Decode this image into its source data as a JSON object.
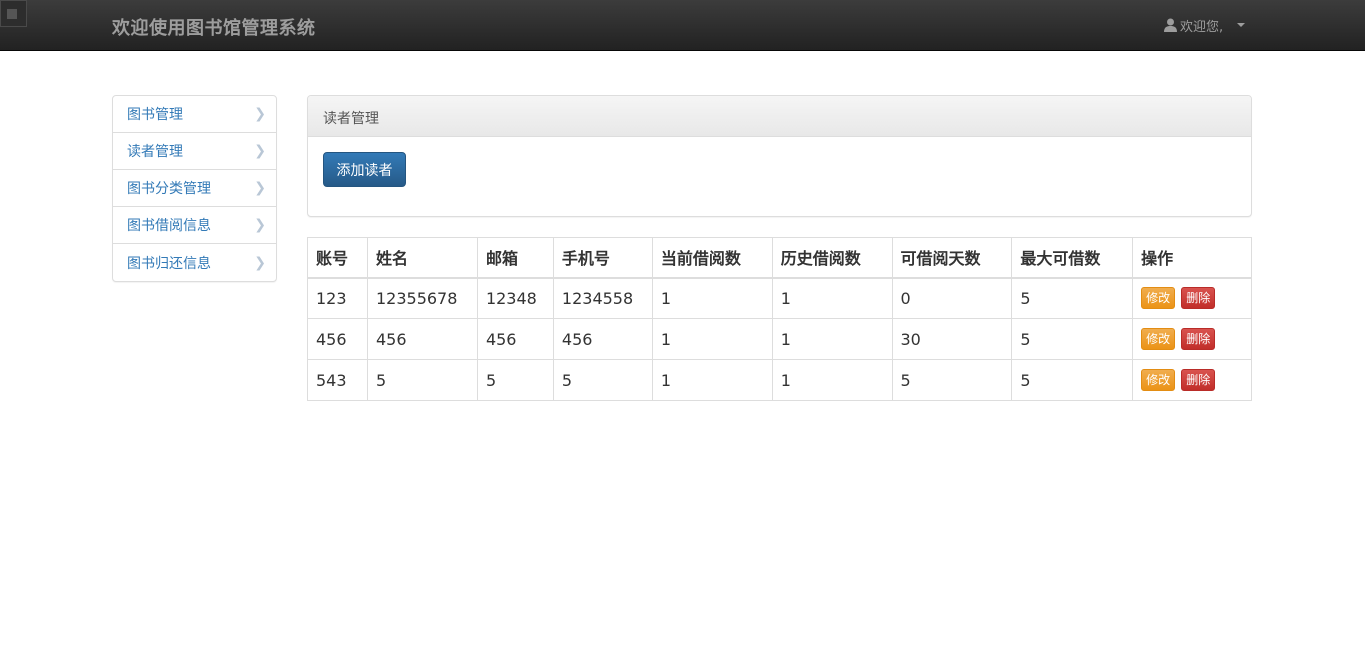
{
  "header": {
    "brand": "欢迎使用图书馆管理系统",
    "welcome": "欢迎您,"
  },
  "sidebar": {
    "items": [
      {
        "label": "图书管理"
      },
      {
        "label": "读者管理"
      },
      {
        "label": "图书分类管理"
      },
      {
        "label": "图书借阅信息"
      },
      {
        "label": "图书归还信息"
      }
    ]
  },
  "panel": {
    "title": "读者管理",
    "add_button": "添加读者"
  },
  "table": {
    "columns": [
      "账号",
      "姓名",
      "邮箱",
      "手机号",
      "当前借阅数",
      "历史借阅数",
      "可借阅天数",
      "最大可借数",
      "操作"
    ],
    "rows": [
      [
        "123",
        "12355678",
        "12348",
        "1234558",
        "1",
        "1",
        "0",
        "5"
      ],
      [
        "456",
        "456",
        "456",
        "456",
        "1",
        "1",
        "30",
        "5"
      ],
      [
        "543",
        "5",
        "5",
        "5",
        "1",
        "1",
        "5",
        "5"
      ]
    ],
    "edit_label": "修改",
    "delete_label": "删除"
  },
  "icons": {
    "user": "user-icon",
    "caret": "caret-down-icon",
    "chevron": "chevron-right-icon"
  },
  "colors": {
    "navbar": "#222222",
    "link": "#337ab7",
    "primary": "#286090",
    "warning": "#f0ad4e",
    "danger": "#d9534f"
  }
}
